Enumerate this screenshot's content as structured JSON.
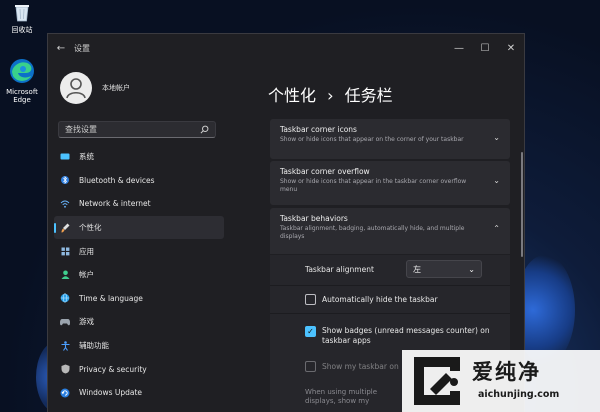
{
  "desktop": {
    "icons": [
      {
        "label": "回收站",
        "icon": "recycle-bin-icon"
      },
      {
        "label": "Microsoft Edge",
        "icon": "edge-icon"
      }
    ]
  },
  "window": {
    "title": "设置",
    "controls": [
      "minimize-icon",
      "maximize-icon",
      "close-icon"
    ]
  },
  "profile": {
    "name": "本地帐户"
  },
  "search": {
    "placeholder": "查找设置"
  },
  "nav": {
    "items": [
      {
        "label": "系统",
        "icon": "system-icon",
        "color": "#4cc2ff"
      },
      {
        "label": "Bluetooth & devices",
        "icon": "bluetooth-icon",
        "color": "#4c9fff"
      },
      {
        "label": "Network & internet",
        "icon": "wifi-icon",
        "color": "#6ab7ff"
      },
      {
        "label": "个性化",
        "icon": "brush-icon",
        "color": "#e8e8e8",
        "active": true
      },
      {
        "label": "应用",
        "icon": "apps-icon",
        "color": "#8fb9e0"
      },
      {
        "label": "帐户",
        "icon": "account-icon",
        "color": "#3fcf8e"
      },
      {
        "label": "Time & language",
        "icon": "globe-icon",
        "color": "#4cc2ff"
      },
      {
        "label": "游戏",
        "icon": "gamepad-icon",
        "color": "#9aa3ad"
      },
      {
        "label": "辅助功能",
        "icon": "accessibility-icon",
        "color": "#4c9fff"
      },
      {
        "label": "Privacy & security",
        "icon": "shield-icon",
        "color": "#b8b8b8"
      },
      {
        "label": "Windows Update",
        "icon": "update-icon",
        "color": "#4cc2ff"
      }
    ]
  },
  "breadcrumb": {
    "parent": "个性化",
    "separator": "›",
    "current": "任务栏"
  },
  "sections": {
    "corner_icons": {
      "title": "Taskbar corner icons",
      "desc": "Show or hide icons that appear on the corner of your taskbar"
    },
    "corner_overflow": {
      "title": "Taskbar corner overflow",
      "desc": "Show or hide icons that appear in the taskbar corner overflow menu"
    },
    "behaviors": {
      "title": "Taskbar behaviors",
      "desc": "Taskbar alignment, badging, automatically hide, and multiple displays",
      "alignment_label": "Taskbar alignment",
      "alignment_value": "左",
      "auto_hide": {
        "label": "Automatically hide the taskbar",
        "checked": false
      },
      "badges": {
        "label": "Show badges (unread messages counter) on taskbar apps",
        "checked": true
      },
      "all_displays": {
        "label": "Show my taskbar on",
        "checked": false
      },
      "multi_display": {
        "label": "When using multiple displays, show my"
      }
    }
  },
  "watermark": {
    "cn": "爱纯净",
    "en": "aichunjing.com"
  },
  "colors": {
    "accent": "#4cc2ff",
    "window_bg": "#1f1f23",
    "panel_bg": "#2b2b30"
  }
}
